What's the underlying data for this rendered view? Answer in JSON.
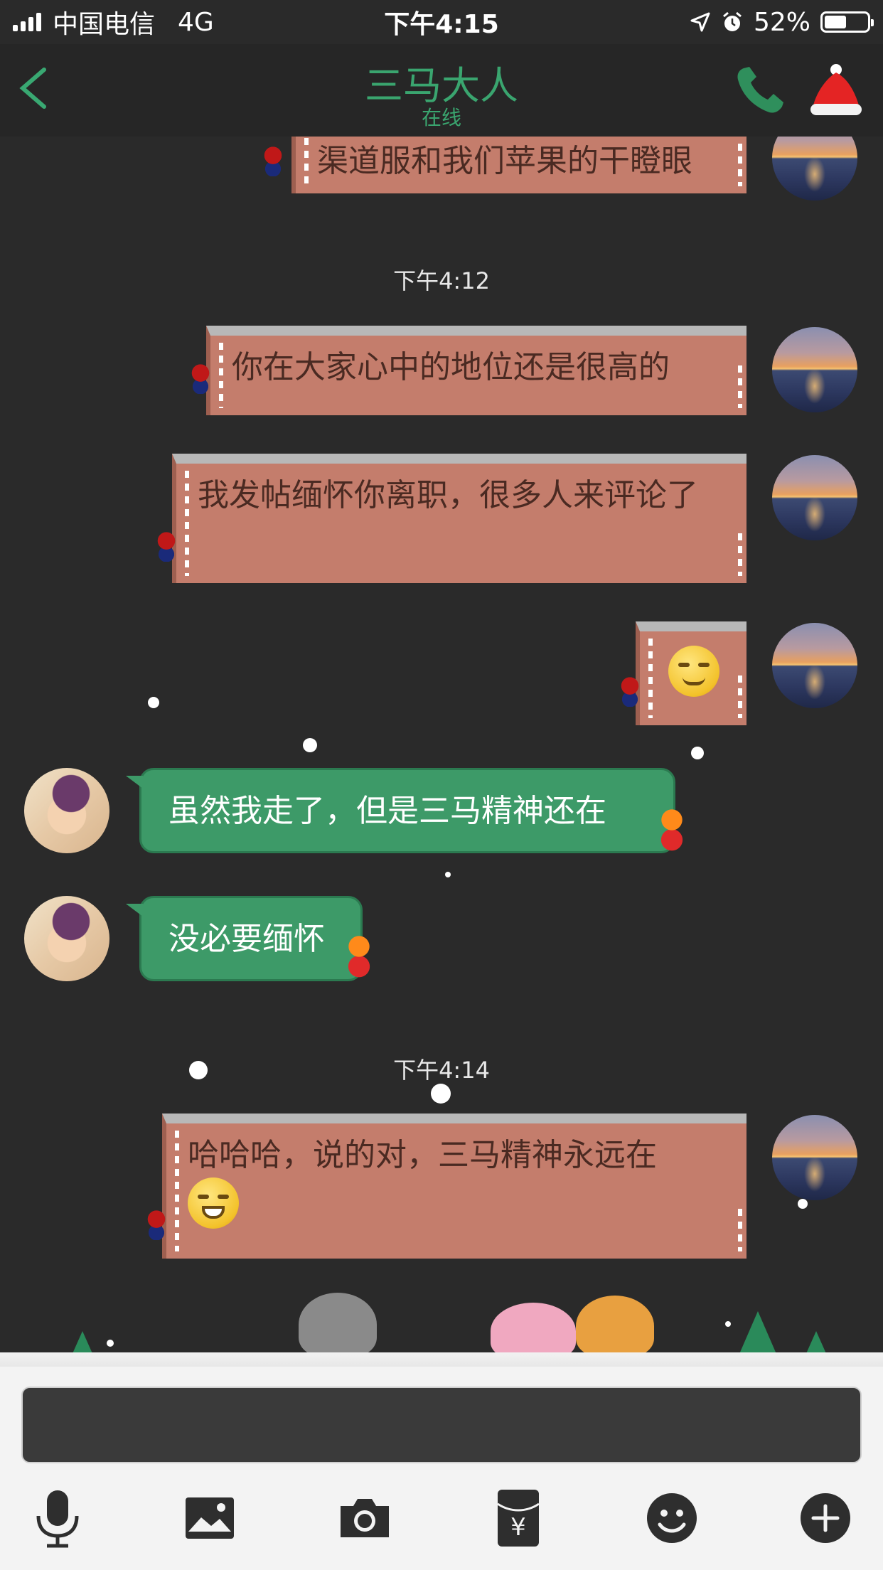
{
  "status_bar": {
    "carrier": "中国电信",
    "network": "4G",
    "time": "下午4:15",
    "battery_percent": "52%",
    "battery_level": 0.52
  },
  "nav": {
    "title": "三马大人",
    "subtitle": "在线",
    "accent_color": "#3aa56f"
  },
  "chat": {
    "messages": [
      {
        "sender": "self",
        "text": "渠道服和我们苹果的干瞪眼"
      },
      {
        "type": "timestamp",
        "text": "下午4:12"
      },
      {
        "sender": "self",
        "text": "你在大家心中的地位还是很高的"
      },
      {
        "sender": "self",
        "text": "我发帖缅怀你离职，很多人来评论了"
      },
      {
        "sender": "self",
        "emoji": "smirk-emoji"
      },
      {
        "sender": "other",
        "text": "虽然我走了，但是三马精神还在"
      },
      {
        "sender": "other",
        "text": "没必要缅怀"
      },
      {
        "type": "timestamp",
        "text": "下午4:14"
      },
      {
        "sender": "self",
        "text": "哈哈哈，说的对，三马精神永远在",
        "emoji": "grin-emoji"
      }
    ]
  },
  "toolbar": {
    "icons": [
      "microphone-icon",
      "image-icon",
      "camera-icon",
      "red-packet-icon",
      "emoji-icon",
      "plus-icon"
    ],
    "red_packet_symbol": "¥"
  },
  "colors": {
    "background": "#2a2a2a",
    "self_bubble": "#c47d6c",
    "other_bubble": "#3d9a68"
  }
}
